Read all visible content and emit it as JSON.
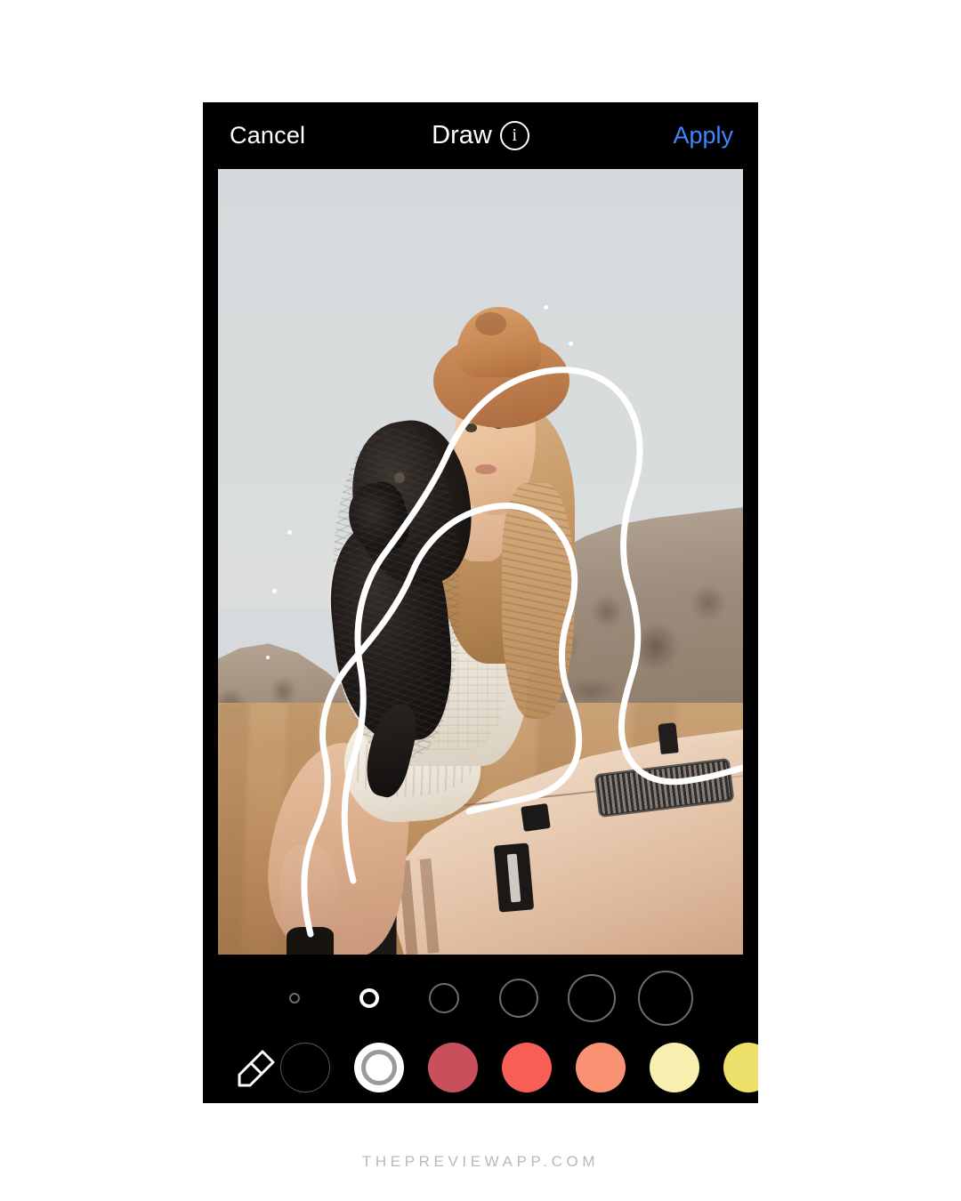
{
  "app": {
    "screen_title": "Draw",
    "info_icon": "info-icon"
  },
  "topbar": {
    "cancel_label": "Cancel",
    "title": "Draw",
    "apply_label": "Apply",
    "apply_color": "#3f87ff",
    "background": "#000000"
  },
  "canvas": {
    "description": "Photo of a woman wearing a tan fedora hat and white knit sweater holding a black curly-haired dog, sitting on the hood of a cream Jeep in a golden field with mountains behind",
    "sky_color": "#d6dadc",
    "field_color": "#c79b6d",
    "jeep_color": "#eed7c2",
    "stroke_color": "#ffffff",
    "stroke_count": 2,
    "sparkle_dots": 5
  },
  "brush_sizes": {
    "label": "Brush size",
    "selected_index": 1,
    "options": [
      {
        "name": "size-1",
        "diameter": 12
      },
      {
        "name": "size-2",
        "diameter": 22
      },
      {
        "name": "size-3",
        "diameter": 34
      },
      {
        "name": "size-4",
        "diameter": 44
      },
      {
        "name": "size-5",
        "diameter": 54
      },
      {
        "name": "size-6",
        "diameter": 62
      }
    ]
  },
  "colors": {
    "label": "Color palette",
    "eraser_icon": "eraser-icon",
    "selected_index": 1,
    "swatches": [
      {
        "name": "black",
        "hex": "#000000",
        "outlined": true
      },
      {
        "name": "white",
        "hex": "#ffffff",
        "selected": true
      },
      {
        "name": "rose-red",
        "hex": "#c8505c"
      },
      {
        "name": "coral-red",
        "hex": "#f85e58"
      },
      {
        "name": "salmon",
        "hex": "#fb9173"
      },
      {
        "name": "cream-yellow",
        "hex": "#f7eeb0"
      },
      {
        "name": "yellow",
        "hex": "#ede06a"
      }
    ]
  },
  "watermark": {
    "text": "THEPREVIEWAPP.COM",
    "color": "#b9b9bd"
  }
}
